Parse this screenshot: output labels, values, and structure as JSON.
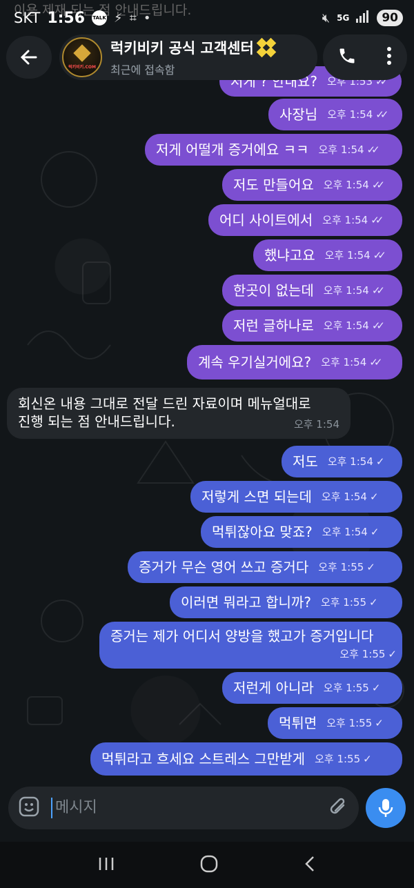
{
  "status_bar": {
    "carrier": "SKT",
    "time": "1:56",
    "talk": "TALK",
    "network": "5G",
    "battery": "90"
  },
  "header": {
    "title": "럭키비키 공식 고객센터",
    "subtitle": "최근에 접속함",
    "avatar_text": "럭키비키.COM"
  },
  "top_faded_text": "이용 제재 되는 점 안내드립니다.",
  "messages": [
    {
      "text": "저게 ? 안내요?",
      "time": "오후 1:53",
      "status": "read"
    },
    {
      "text": "사장님",
      "time": "오후 1:54",
      "status": "read"
    },
    {
      "text": "저게 어떨개 증거에요 ㅋㅋ",
      "time": "오후 1:54",
      "status": "read"
    },
    {
      "text": "저도 만들어요",
      "time": "오후 1:54",
      "status": "read"
    },
    {
      "text": "어디 사이트에서",
      "time": "오후 1:54",
      "status": "read"
    },
    {
      "text": "했냐고요",
      "time": "오후 1:54",
      "status": "read"
    },
    {
      "text": "한곳이 없는데",
      "time": "오후 1:54",
      "status": "read"
    },
    {
      "text": "저런 글하나로",
      "time": "오후 1:54",
      "status": "read"
    },
    {
      "text": "계속 우기실거에요?",
      "time": "오후 1:54",
      "status": "read"
    },
    {
      "text_line1": "회신온 내용 그대로 전달 드린 자료이며 메뉴얼대로",
      "text_line2": "진행 되는 점 안내드립니다.",
      "time": "오후 1:54"
    },
    {
      "text": "저도",
      "time": "오후 1:54",
      "status": "sent"
    },
    {
      "text": "저렇게 스면 되는데",
      "time": "오후 1:54",
      "status": "sent"
    },
    {
      "text": "먹튀잖아요 맞죠?",
      "time": "오후 1:54",
      "status": "sent"
    },
    {
      "text": "증거가 무슨 영어 쓰고 증거다",
      "time": "오후 1:55",
      "status": "sent"
    },
    {
      "text": "이러면 뭐라고 합니까?",
      "time": "오후 1:55",
      "status": "sent"
    },
    {
      "text": "증거는 제가 어디서 양방을 했고가 증거입니다",
      "time": "오후 1:55",
      "status": "sent"
    },
    {
      "text": "저런게 아니라",
      "time": "오후 1:55",
      "status": "sent"
    },
    {
      "text": "먹튀면",
      "time": "오후 1:55",
      "status": "sent"
    },
    {
      "text": "먹튀라고 흐세요 스트레스 그만받게",
      "time": "오후 1:55",
      "status": "sent"
    }
  ],
  "composer": {
    "placeholder": "메시지"
  },
  "colors": {
    "read_bubble": "#7c4fd1",
    "sent_bubble": "#4b60d6",
    "incoming_bubble": "#23272b",
    "mic_button": "#3a8df0"
  }
}
